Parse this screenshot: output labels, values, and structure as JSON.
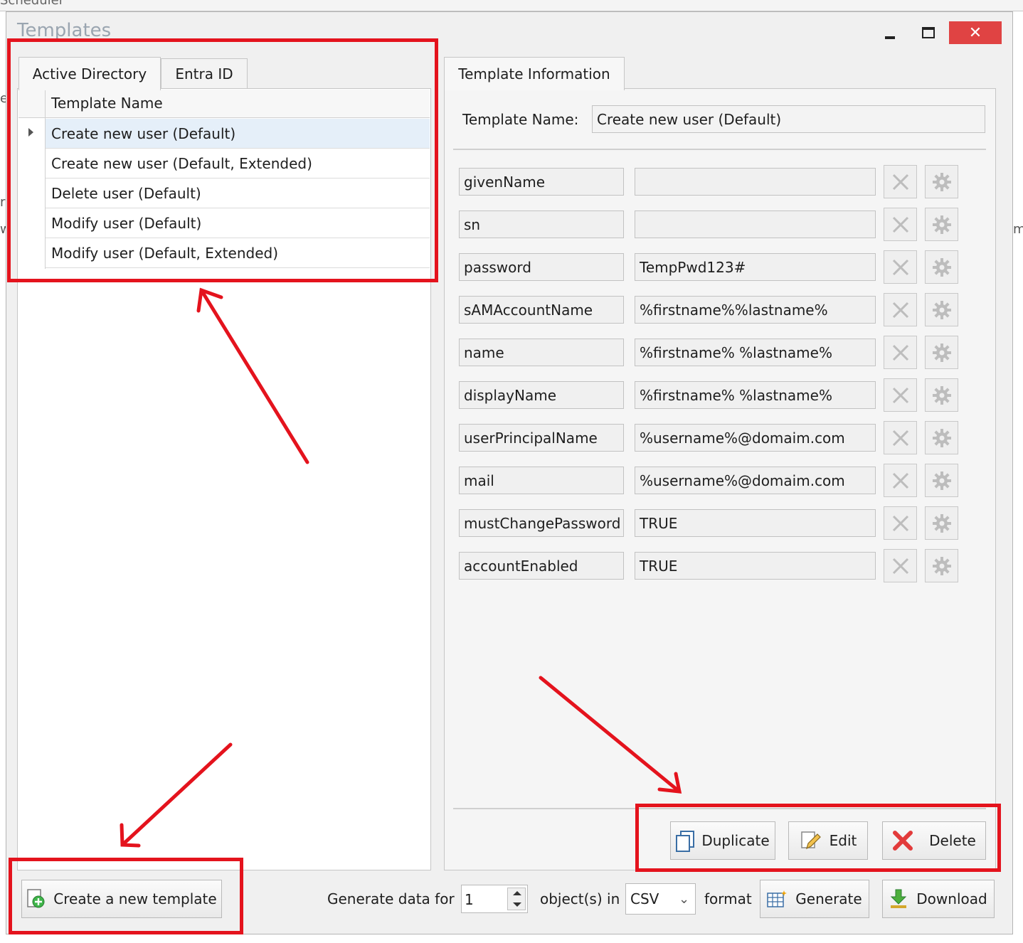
{
  "background_window": {
    "title": "Scheduler",
    "fragments": [
      "er",
      "r",
      "w",
      "m"
    ]
  },
  "window": {
    "title": "Templates",
    "controls": {
      "minimize": "minimize-icon",
      "maximize": "maximize-icon",
      "close": "close-icon"
    }
  },
  "left_tabs": [
    {
      "label": "Active Directory",
      "active": true
    },
    {
      "label": "Entra ID",
      "active": false
    }
  ],
  "templates_grid": {
    "column_header": "Template Name",
    "rows": [
      {
        "name": "Create new user (Default)",
        "selected": true
      },
      {
        "name": "Create new user (Default, Extended)",
        "selected": false
      },
      {
        "name": "Delete user (Default)",
        "selected": false
      },
      {
        "name": "Modify user (Default)",
        "selected": false
      },
      {
        "name": "Modify user (Default, Extended)",
        "selected": false
      }
    ]
  },
  "right_tab": {
    "label": "Template Information"
  },
  "template_info": {
    "name_label": "Template Name:",
    "name_value": "Create new user (Default)",
    "attributes": [
      {
        "name": "givenName",
        "value": ""
      },
      {
        "name": "sn",
        "value": ""
      },
      {
        "name": "password",
        "value": "TempPwd123#"
      },
      {
        "name": "sAMAccountName",
        "value": "%firstname%%lastname%"
      },
      {
        "name": "name",
        "value": "%firstname% %lastname%"
      },
      {
        "name": "displayName",
        "value": "%firstname% %lastname%"
      },
      {
        "name": "userPrincipalName",
        "value": "%username%@domaim.com"
      },
      {
        "name": "mail",
        "value": "%username%@domaim.com"
      },
      {
        "name": "mustChangePassword",
        "value": "TRUE"
      },
      {
        "name": "accountEnabled",
        "value": "TRUE"
      }
    ],
    "row_icons": {
      "remove": "close-x-icon",
      "settings": "gear-icon"
    }
  },
  "actions": {
    "duplicate": "Duplicate",
    "edit": "Edit",
    "delete": "Delete"
  },
  "footer": {
    "create_button": "Create a new template",
    "generate_prefix": "Generate data for",
    "count_value": "1",
    "objects_label": "object(s) in",
    "format_value": "CSV",
    "format_label": "format",
    "generate_button": "Generate",
    "download_button": "Download"
  },
  "annotation_color": "#e4131d"
}
